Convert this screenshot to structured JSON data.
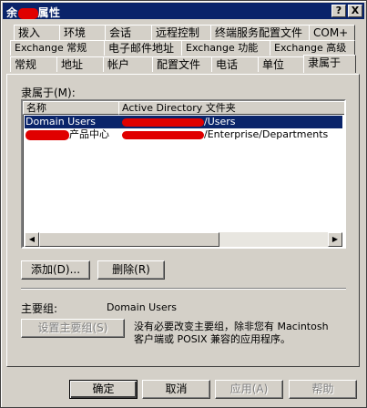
{
  "window": {
    "title_prefix": "余",
    "title_suffix": "属性",
    "help_glyph": "?",
    "close_glyph": "X"
  },
  "tabs": {
    "row1": [
      "拨入",
      "环境",
      "会话",
      "远程控制",
      "终端服务配置文件",
      "COM+"
    ],
    "row2": [
      "Exchange 常规",
      "电子邮件地址",
      "Exchange 功能",
      "Exchange 高级"
    ],
    "row3": [
      "常规",
      "地址",
      "帐户",
      "配置文件",
      "电话",
      "单位",
      "隶属于"
    ],
    "active": "隶属于"
  },
  "member_of": {
    "label": "隶属于(M):",
    "columns": [
      "名称",
      "Active Directory 文件夹"
    ],
    "rows": [
      {
        "name": "Domain Users",
        "folder_suffix": "/Users",
        "selected": true
      },
      {
        "name_suffix": "产品中心",
        "folder_suffix": "/Enterprise/Departments",
        "selected": false
      }
    ],
    "add_button": "添加(D)...",
    "remove_button": "删除(R)"
  },
  "primary_group": {
    "label": "主要组:",
    "value": "Domain Users",
    "set_button": "设置主要组(S)",
    "note_line1": "没有必要改变主要组，除非您有 Macintosh",
    "note_line2": "客户端或 POSIX 兼容的应用程序。"
  },
  "footer": {
    "ok": "确定",
    "cancel": "取消",
    "apply": "应用(A)",
    "help": "帮助"
  },
  "colors": {
    "title_bg": "#0a246a",
    "face": "#d4d0c8",
    "redaction": "#e00000"
  }
}
